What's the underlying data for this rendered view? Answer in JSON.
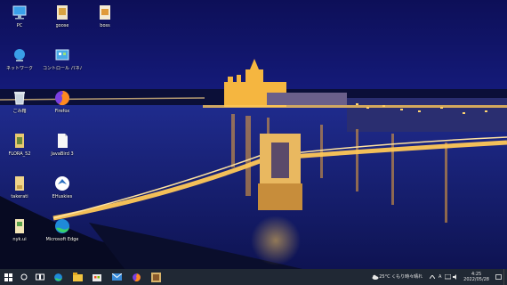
{
  "desktop": {
    "icons": [
      {
        "label": "PC",
        "icon": "pc-icon"
      },
      {
        "label": "goose",
        "icon": "folder-icon"
      },
      {
        "label": "boss",
        "icon": "document-icon"
      },
      {
        "label": "ネットワーク",
        "icon": "network-icon"
      },
      {
        "label": "コントロール パネル",
        "icon": "control-panel-icon"
      },
      {
        "label": "ごみ箱",
        "icon": "recycle-bin-icon"
      },
      {
        "label": "Firefox",
        "icon": "firefox-icon"
      },
      {
        "label": "FLORA_52",
        "icon": "folder-icon"
      },
      {
        "label": "JavaBird 3",
        "icon": "document-icon"
      },
      {
        "label": "takerati",
        "icon": "file-icon"
      },
      {
        "label": "EHuskies",
        "icon": "app-icon"
      },
      {
        "label": "nyk.ui",
        "icon": "file-icon"
      },
      {
        "label": "Microsoft Edge",
        "icon": "edge-icon"
      }
    ]
  },
  "taskbar": {
    "pinned": [
      "start-icon",
      "search-icon",
      "task-view-icon",
      "edge-icon",
      "file-explorer-icon",
      "store-icon",
      "mail-icon",
      "firefox-icon",
      "app-icon"
    ],
    "tray": {
      "weather": "25°C くもり時々晴れ",
      "ime": "A",
      "time": "4:25",
      "date": "2022/05/28"
    }
  },
  "colors": {
    "sky": "#0f1466",
    "taskbar": "#202834",
    "accent": "#3a8bd8"
  }
}
